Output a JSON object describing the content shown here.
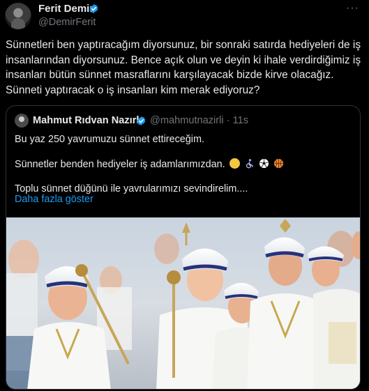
{
  "author": {
    "name": "Ferit Demir",
    "handle": "@DemirFerit",
    "verified": true
  },
  "post": {
    "text": "Sünnetleri ben yaptıracağım diyorsunuz, bir sonraki satırda hediyeleri de iş insanlarından diyorsunuz. Bence açık olun ve deyin ki ihale verdirdiğimiz iş insanları bütün sünnet masraflarını karşılayacak bizde kirve olacağız. Sünneti yaptıracak o iş insanları kim merak ediyoruz?"
  },
  "more_icon": "···",
  "quoted": {
    "name": "Mahmut Rıdvan Nazırlı",
    "handle": "@mahmutnazirli",
    "time": "· 11s",
    "line1": "Bu yaz 250 yavrumuzu sünnet ettireceğim.",
    "line2": "Sünnetler benden hediyeler iş adamlarımızdan.",
    "line3": "Toplu sünnet düğünü ile yavrularımızı sevindirelim....",
    "show_more": "Daha fazla göster",
    "emojis": [
      "winking-face-emoji",
      "person-in-wheelchair-emoji",
      "soccer-ball-emoji",
      "basketball-emoji"
    ]
  },
  "colors": {
    "background": "#000000",
    "text": "#e7e9ea",
    "muted": "#71767b",
    "link": "#1d9bf0",
    "border": "#2f3336",
    "verified": "#1d9bf0"
  }
}
